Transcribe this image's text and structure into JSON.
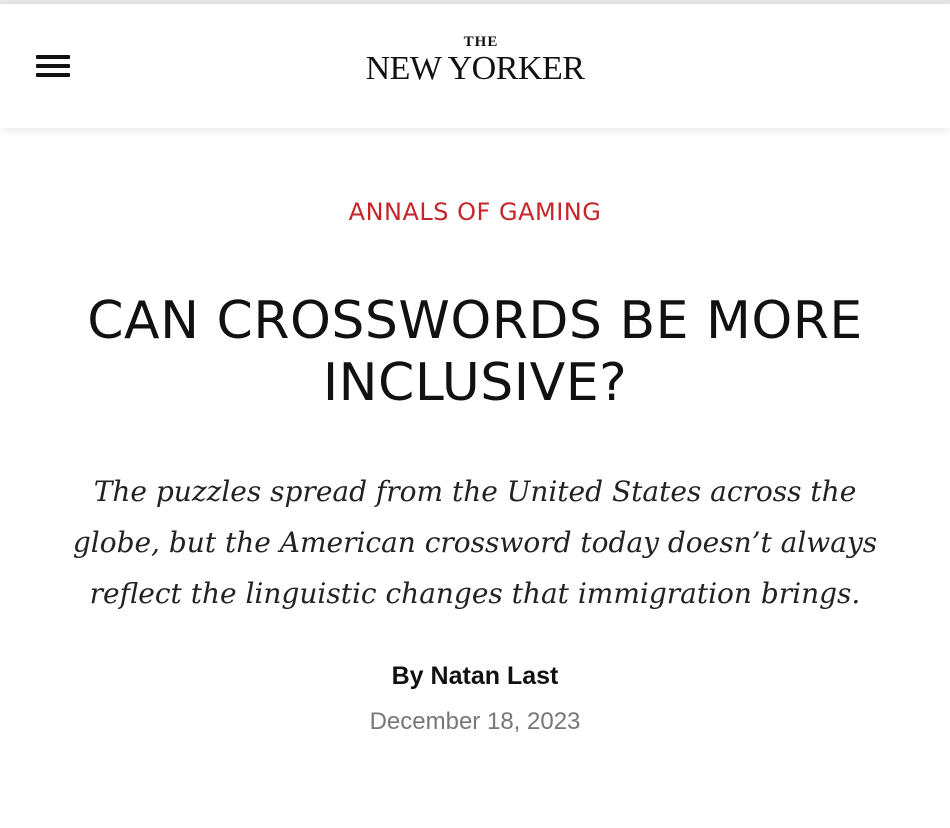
{
  "header": {
    "logo_the": "THE",
    "logo_name": "NEW YORKER",
    "menu_icon": "hamburger-menu-icon"
  },
  "article": {
    "rubric": "ANNALS OF GAMING",
    "headline": "CAN CROSSWORDS BE MORE INCLUSIVE?",
    "dek": "The puzzles spread from the United States across the globe, but the American crossword today doesn’t always reflect the linguistic changes that immigration brings.",
    "byline_prefix": "By",
    "author": "Natan Last",
    "date": "December 18, 2023"
  },
  "colors": {
    "rubric": "#c6262a",
    "text": "#111111",
    "date": "#777777",
    "background": "#ffffff"
  }
}
